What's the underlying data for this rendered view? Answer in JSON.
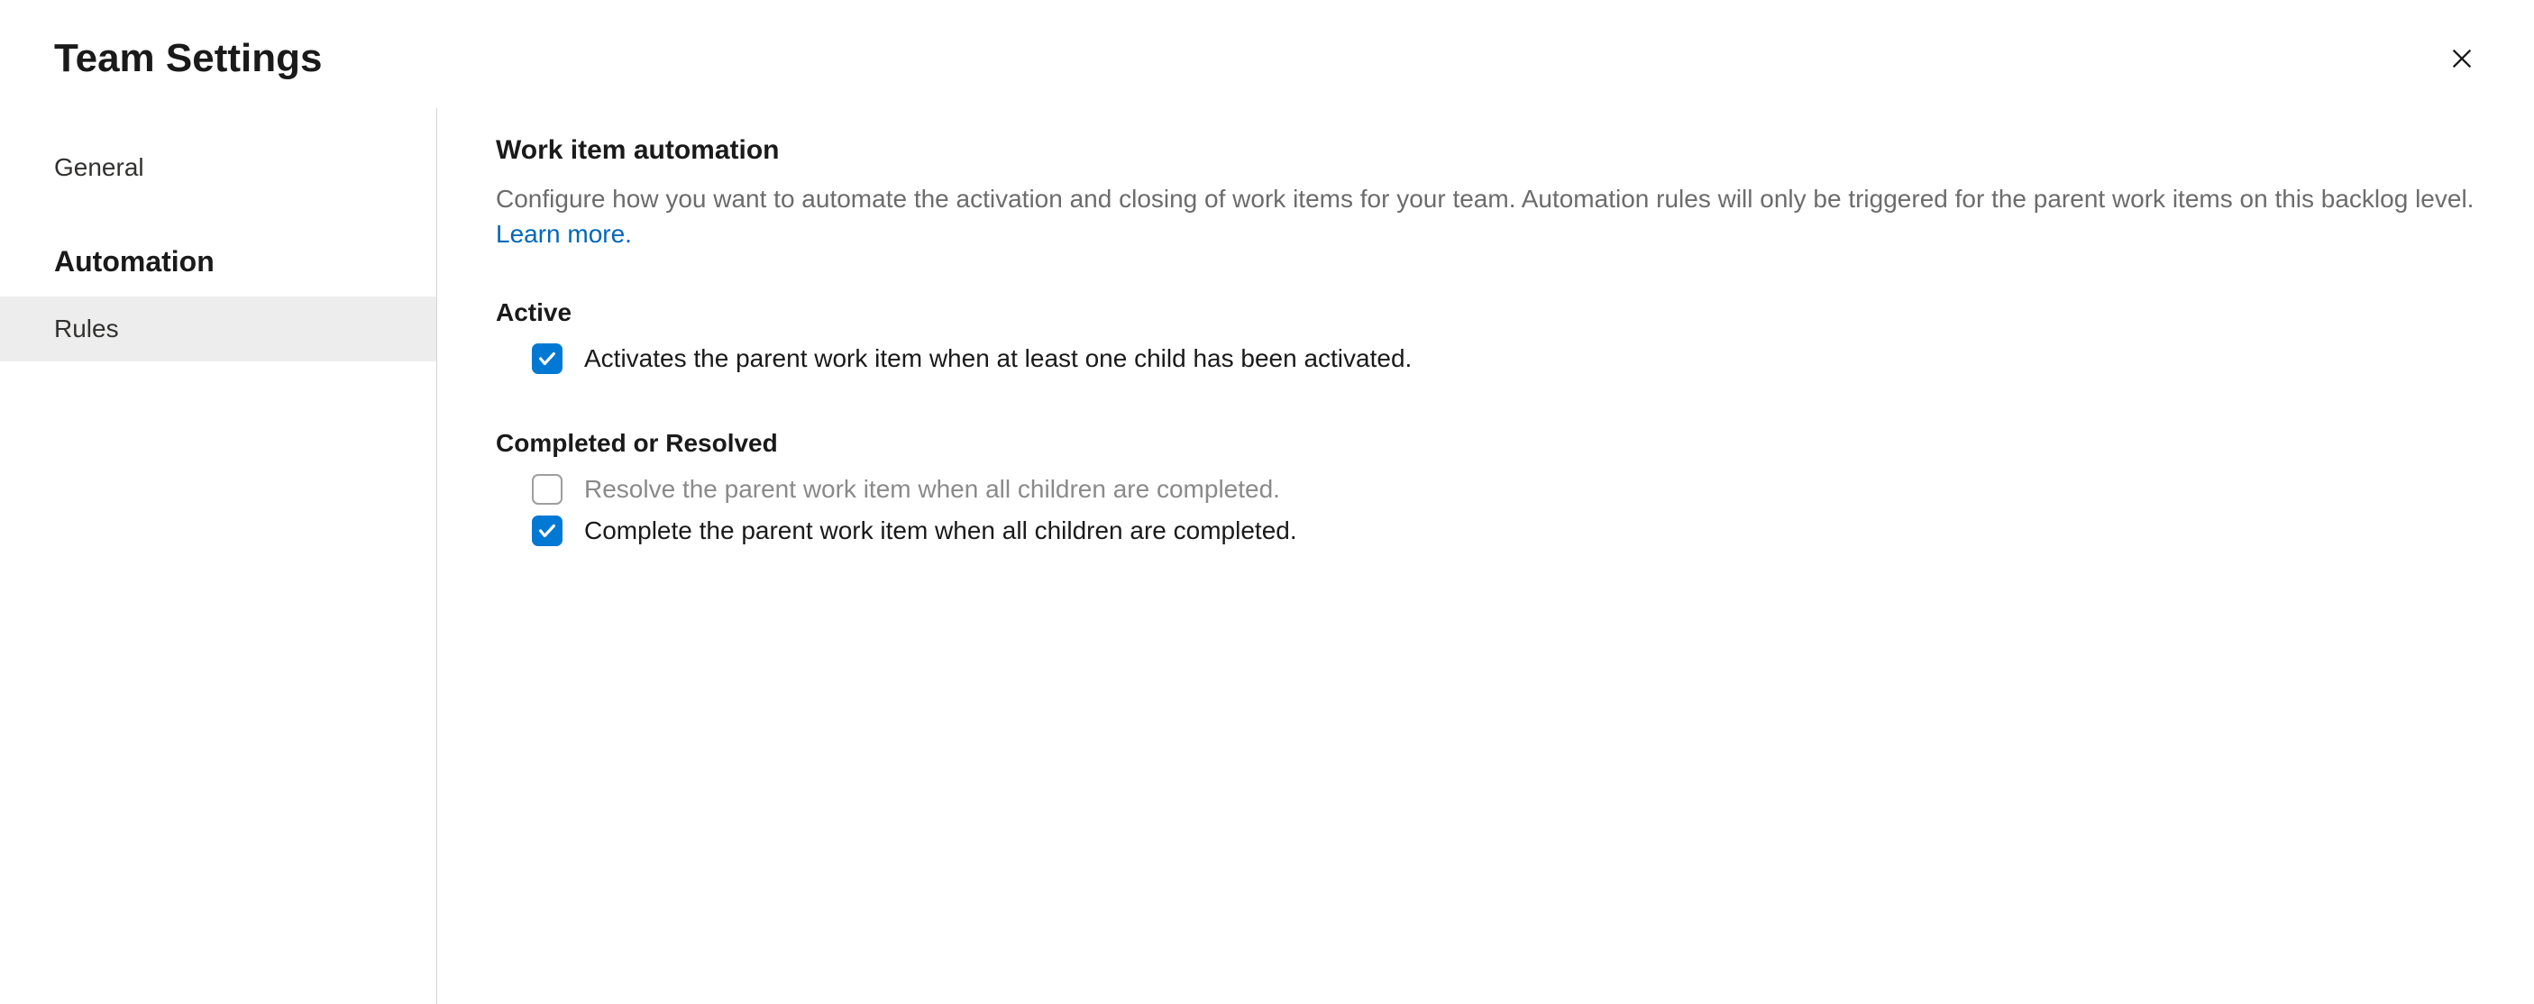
{
  "header": {
    "title": "Team Settings"
  },
  "sidebar": {
    "items": [
      {
        "label": "General",
        "type": "item",
        "data_name": "sidebar-item-general"
      },
      {
        "label": "Automation",
        "type": "heading",
        "data_name": "sidebar-heading-automation"
      },
      {
        "label": "Rules",
        "type": "item",
        "selected": true,
        "data_name": "sidebar-item-rules"
      }
    ]
  },
  "content": {
    "section_title": "Work item automation",
    "section_desc": "Configure how you want to automate the activation and closing of work items for your team. Automation rules will only be triggered for the parent work items on this backlog level.",
    "learn_more": "Learn more.",
    "groups": [
      {
        "title": "Active",
        "rules": [
          {
            "label": "Activates the parent work item when at least one child has been activated.",
            "checked": true,
            "disabled": false,
            "data_name": "rule-activate-parent"
          }
        ]
      },
      {
        "title": "Completed or Resolved",
        "rules": [
          {
            "label": "Resolve the parent work item when all children are completed.",
            "checked": false,
            "disabled": true,
            "data_name": "rule-resolve-parent"
          },
          {
            "label": "Complete the parent work item when all children are completed.",
            "checked": true,
            "disabled": false,
            "data_name": "rule-complete-parent"
          }
        ]
      }
    ]
  }
}
